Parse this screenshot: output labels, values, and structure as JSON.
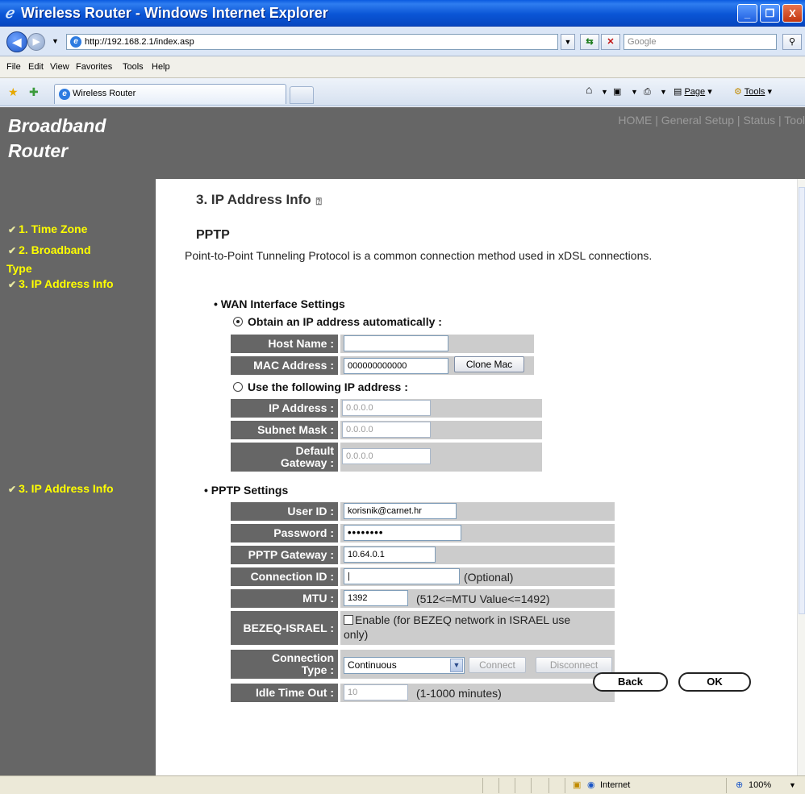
{
  "window": {
    "title": "Wireless Router - Windows Internet Explorer",
    "minimize": "_",
    "maximize": "❐",
    "close": "X"
  },
  "addressbar": {
    "url": "http://192.168.2.1/index.asp",
    "search_placeholder": "Google"
  },
  "menu": [
    "File",
    "Edit",
    "View",
    "Favorites",
    "Tools",
    "Help"
  ],
  "tabs": {
    "active_label": "Wireless Router"
  },
  "commandbar": {
    "page": "Page",
    "tools": "Tools"
  },
  "header": {
    "brand_line1": "Broadband",
    "brand_line2": "Router",
    "nav": "HOME | General Setup | Status | Tool"
  },
  "sidebar": {
    "items": [
      "1. Time Zone",
      "2. Broadband",
      "Type",
      "3. IP Address Info",
      "3. IP Address Info"
    ]
  },
  "main": {
    "page_title": "3. IP Address Info",
    "section_title": "PPTP",
    "description": "Point-to-Point Tunneling Protocol is a common connection method used in xDSL connections.",
    "wan": {
      "heading": "WAN Interface Settings",
      "auto_label": "Obtain an IP address automatically :",
      "host_name_label": "Host Name :",
      "host_name_value": "",
      "mac_label": "MAC Address :",
      "mac_value": "000000000000",
      "clone_mac": "Clone Mac",
      "manual_label": "Use the following IP address :",
      "ip_label": "IP Address :",
      "ip_value": "0.0.0.0",
      "subnet_label": "Subnet Mask :",
      "subnet_value": "0.0.0.0",
      "gateway_label_1": "Default",
      "gateway_label_2": "Gateway :",
      "gateway_value": "0.0.0.0"
    },
    "pptp": {
      "heading": "PPTP Settings",
      "user_id_label": "User ID :",
      "user_id_value": "korisnik@carnet.hr",
      "password_label": "Password :",
      "password_value": "••••••••",
      "gateway_label": "PPTP Gateway :",
      "gateway_value": "10.64.0.1",
      "conn_id_label": "Connection ID :",
      "conn_id_value": "|",
      "conn_id_note": "(Optional)",
      "mtu_label": "MTU :",
      "mtu_value": "1392",
      "mtu_note": "(512<=MTU Value<=1492)",
      "bezeq_label": "BEZEQ-ISRAEL :",
      "bezeq_note_1": "Enable (for BEZEQ network in ISRAEL use",
      "bezeq_note_2": "only)",
      "conn_type_label_1": "Connection",
      "conn_type_label_2": "Type :",
      "conn_type_value": "Continuous",
      "connect": "Connect",
      "disconnect": "Disconnect",
      "idle_label": "Idle Time Out :",
      "idle_value": "10",
      "idle_note": "(1-1000 minutes)"
    },
    "back": "Back",
    "ok": "OK"
  },
  "statusbar": {
    "zone": "Internet",
    "zoom": "100%"
  }
}
